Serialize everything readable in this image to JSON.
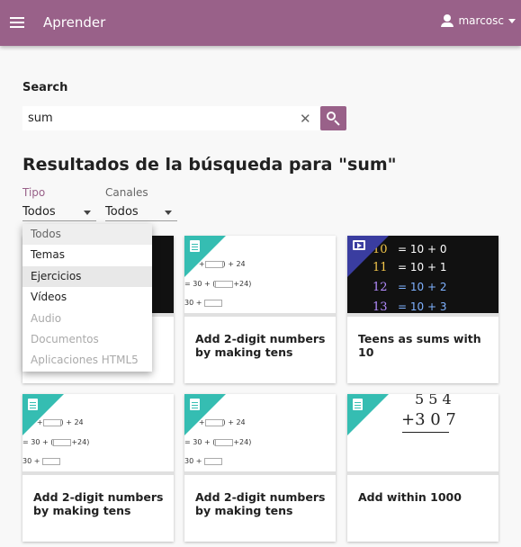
{
  "appbar": {
    "title": "Aprender",
    "username": "marcosc",
    "accent_color": "#996189"
  },
  "search": {
    "label": "Search",
    "value": "sum"
  },
  "results": {
    "heading": "Resultados de la búsqueda para \"sum\""
  },
  "filters": {
    "tipo": {
      "label": "Tipo",
      "value": "Todos"
    },
    "canales": {
      "label": "Canales",
      "value": "Todos"
    }
  },
  "dropdown": {
    "options": [
      {
        "label": "Todos",
        "state": "current"
      },
      {
        "label": "Temas",
        "state": "enabled"
      },
      {
        "label": "Ejercicios",
        "state": "hover"
      },
      {
        "label": "Vídeos",
        "state": "enabled"
      },
      {
        "label": "Audio",
        "state": "disabled"
      },
      {
        "label": "Documentos",
        "state": "disabled"
      },
      {
        "label": "Aplicaciones HTML5",
        "state": "disabled"
      }
    ]
  },
  "cards": [
    {
      "title": "",
      "kind": "exercise-icon"
    },
    {
      "title": "Add 2-digit numbers by making tens",
      "kind": "exercise-icon"
    },
    {
      "title": "Teens as sums with 10",
      "kind": "video-icon"
    },
    {
      "title": "Add 2-digit numbers by making tens",
      "kind": "exercise-icon"
    },
    {
      "title": "Add 2-digit numbers by making tens",
      "kind": "exercise-icon"
    },
    {
      "title": "Add within 1000",
      "kind": "exercise-icon"
    }
  ],
  "thumb_text": {
    "eq_line1_a": "(30 +",
    "eq_line1_b": ") + 24",
    "eq_line2_a": "= 30 + (",
    "eq_line2_b": "+24)",
    "eq_line3": "30 +",
    "teens": [
      {
        "n": "10",
        "r": "= 10 + 0"
      },
      {
        "n": "11",
        "r": "= 10 + 1"
      },
      {
        "n": "12",
        "r": "= 10 + 2"
      },
      {
        "n": "13",
        "r": "= 10 + 3"
      }
    ],
    "add_top": "5 5 4",
    "add_bottom": "+3 0 7"
  },
  "colors": {
    "exercise_ribbon": "#35bdb2",
    "video_ribbon": "#3a3da0",
    "chalk_colors": [
      "#f3c64a",
      "#ffffff",
      "#7fb2ff",
      "#b48cff"
    ]
  }
}
